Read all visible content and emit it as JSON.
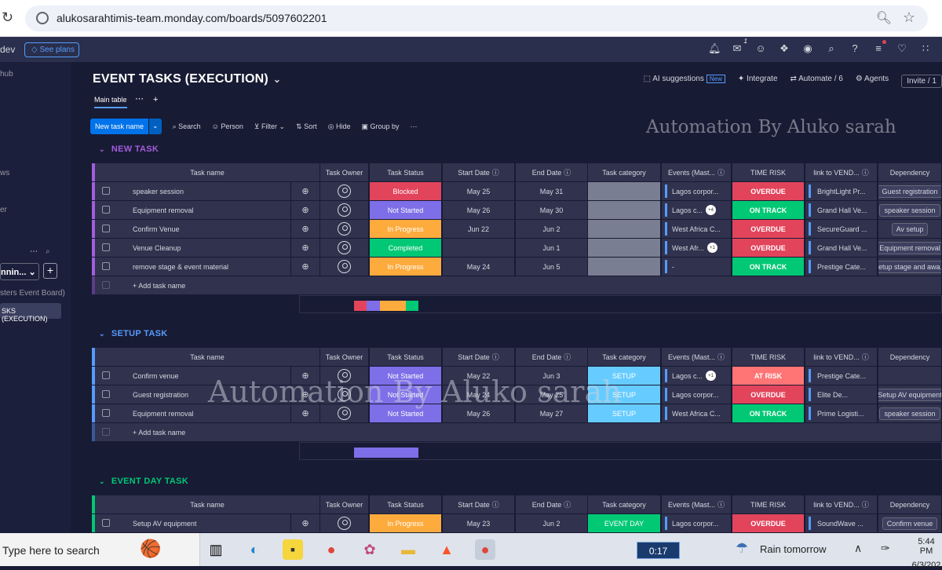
{
  "browser": {
    "url": "alukosarahtimis-team.monday.com/boards/5097602201"
  },
  "appbar": {
    "workspace_fragment": "dev",
    "see_plans": "See plans",
    "notif_badge": "1"
  },
  "sidebar": {
    "frag1": "hub",
    "frag2": "ws",
    "frag3": "er",
    "select_label": "nnin...",
    "board_sub": "sters Event Board)",
    "active_board": "SKS (EXECUTION)"
  },
  "board": {
    "title": "EVENT TASKS (EXECUTION)",
    "main_table": "Main table",
    "ai": "AI suggestions",
    "ai_badge": "New",
    "integrate": "Integrate",
    "automate": "Automate / 6",
    "agents": "Agents",
    "invite": "Invite / 1"
  },
  "toolbar": {
    "new_task": "New task name",
    "search": "Search",
    "person": "Person",
    "filter": "Filter",
    "sort": "Sort",
    "hide": "Hide",
    "group_by": "Group by"
  },
  "watermark": "Automation By Aluko sarah",
  "columns": [
    "Task name",
    "Task Owner",
    "Task Status",
    "Start Date",
    "End Date",
    "Task category",
    "Events (Mast...",
    "TIME RISK",
    "link to VEND...",
    "Dependency"
  ],
  "add_task": "+ Add task name",
  "groups": [
    {
      "title": "NEW TASK",
      "color": "#a25ddc",
      "rows": [
        {
          "name": "speaker session",
          "status": "Blocked",
          "status_color": "#e2445c",
          "start": "May 25",
          "end": "May 31",
          "category": "",
          "cat_color": "#797e93",
          "event": "Lagos corpor...",
          "event_badge": "",
          "risk": "OVERDUE",
          "risk_color": "#e2445c",
          "vendor": "BrightLight Pr...",
          "dep": "Guest registration"
        },
        {
          "name": "Equipment removal",
          "status": "Not Started",
          "status_color": "#7e6ee8",
          "start": "May 26",
          "end": "May 30",
          "category": "",
          "cat_color": "#797e93",
          "event": "Lagos c...",
          "event_badge": "+4",
          "risk": "ON TRACK",
          "risk_color": "#00c875",
          "vendor": "Grand Hall Ve...",
          "dep": "speaker session"
        },
        {
          "name": "Confirm Venue",
          "status": "In Progress",
          "status_color": "#fdab3d",
          "start": "Jun 22",
          "end": "Jun 2",
          "category": "",
          "cat_color": "#797e93",
          "event": "West Africa C...",
          "event_badge": "",
          "risk": "OVERDUE",
          "risk_color": "#e2445c",
          "vendor": "SecureGuard ...",
          "dep": "Av setup"
        },
        {
          "name": "Venue Cleanup",
          "status": "Completed",
          "status_color": "#00c875",
          "start": "",
          "end": "Jun 1",
          "category": "",
          "cat_color": "#797e93",
          "event": "West Afr...",
          "event_badge": "+1",
          "risk": "OVERDUE",
          "risk_color": "#e2445c",
          "vendor": "Grand Hall Ve...",
          "dep": "Equipment removal"
        },
        {
          "name": "remove stage & event material",
          "status": "In Progress",
          "status_color": "#fdab3d",
          "start": "May 24",
          "end": "Jun 5",
          "category": "",
          "cat_color": "#797e93",
          "event": "-",
          "event_badge": "",
          "risk": "ON TRACK",
          "risk_color": "#00c875",
          "vendor": "Prestige Cate...",
          "dep": "Setup stage and awa..."
        }
      ]
    },
    {
      "title": "SETUP TASK",
      "color": "#579bfc",
      "rows": [
        {
          "name": "Confirm venue",
          "status": "Not Started",
          "status_color": "#7e6ee8",
          "start": "May 22",
          "end": "Jun 3",
          "category": "SETUP",
          "cat_color": "#66ccff",
          "event": "Lagos c...",
          "event_badge": "+1",
          "risk": "AT RISK",
          "risk_color": "#ff7575",
          "vendor": "Prestige Cate...",
          "dep": ""
        },
        {
          "name": "Guest registration",
          "status": "Not Started",
          "status_color": "#7e6ee8",
          "start": "May 24",
          "end": "May 25",
          "category": "SETUP",
          "cat_color": "#66ccff",
          "event": "Lagos corpor...",
          "event_badge": "",
          "risk": "OVERDUE",
          "risk_color": "#e2445c",
          "vendor": "Elite De...",
          "dep": "Setup AV equipment"
        },
        {
          "name": "Equipment removal",
          "status": "Not Started",
          "status_color": "#7e6ee8",
          "start": "May 26",
          "end": "May 27",
          "category": "SETUP",
          "cat_color": "#66ccff",
          "event": "West Africa C...",
          "event_badge": "",
          "risk": "ON TRACK",
          "risk_color": "#00c875",
          "vendor": "Prime Logisti...",
          "dep": "speaker session"
        }
      ]
    },
    {
      "title": "EVENT DAY TASK",
      "color": "#00c875",
      "rows": [
        {
          "name": "Setup AV equipment",
          "status": "In Progress",
          "status_color": "#fdab3d",
          "start": "May 23",
          "end": "Jun 2",
          "category": "EVENT DAY",
          "cat_color": "#00c875",
          "event": "Lagos corpor...",
          "event_badge": "",
          "risk": "OVERDUE",
          "risk_color": "#e2445c",
          "vendor": "SoundWave ...",
          "dep": "Confirm venue"
        }
      ]
    }
  ],
  "taskbar": {
    "search_placeholder": "Type here to search",
    "timer": "0:17",
    "weather": "Rain tomorrow",
    "time": "5:44 PM",
    "date": "6/3/202"
  }
}
